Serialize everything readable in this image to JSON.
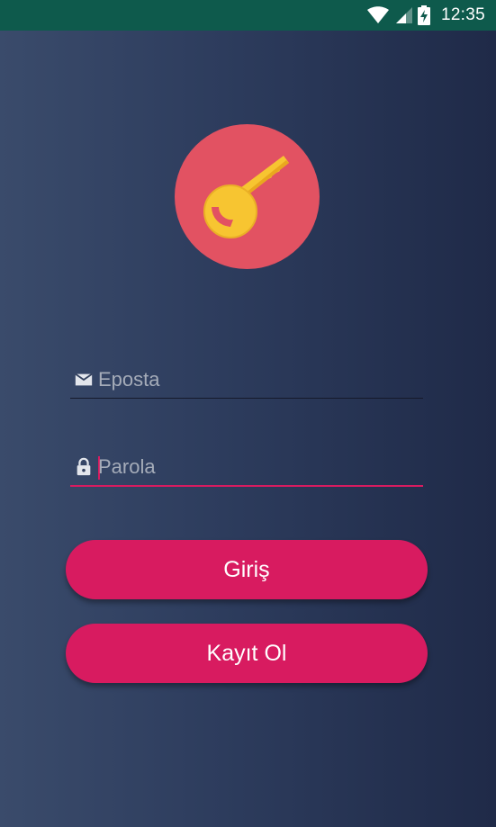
{
  "status_bar": {
    "time": "12:35",
    "icons": [
      "wifi-icon",
      "signal-icon",
      "battery-charging-icon"
    ],
    "color": "#0e5a4c"
  },
  "logo": {
    "icon": "key-icon",
    "circle_color": "#e25262",
    "key_color": "#f7c531"
  },
  "form": {
    "email": {
      "placeholder": "Eposta",
      "value": "",
      "icon": "mail-icon"
    },
    "password": {
      "placeholder": "Parola",
      "value": "",
      "icon": "lock-icon",
      "focused": true
    }
  },
  "buttons": {
    "login_label": "Giriş",
    "register_label": "Kayıt Ol"
  },
  "colors": {
    "accent": "#d81b60",
    "background_left": "#3a4b6b",
    "background_right": "#1f2a48"
  }
}
